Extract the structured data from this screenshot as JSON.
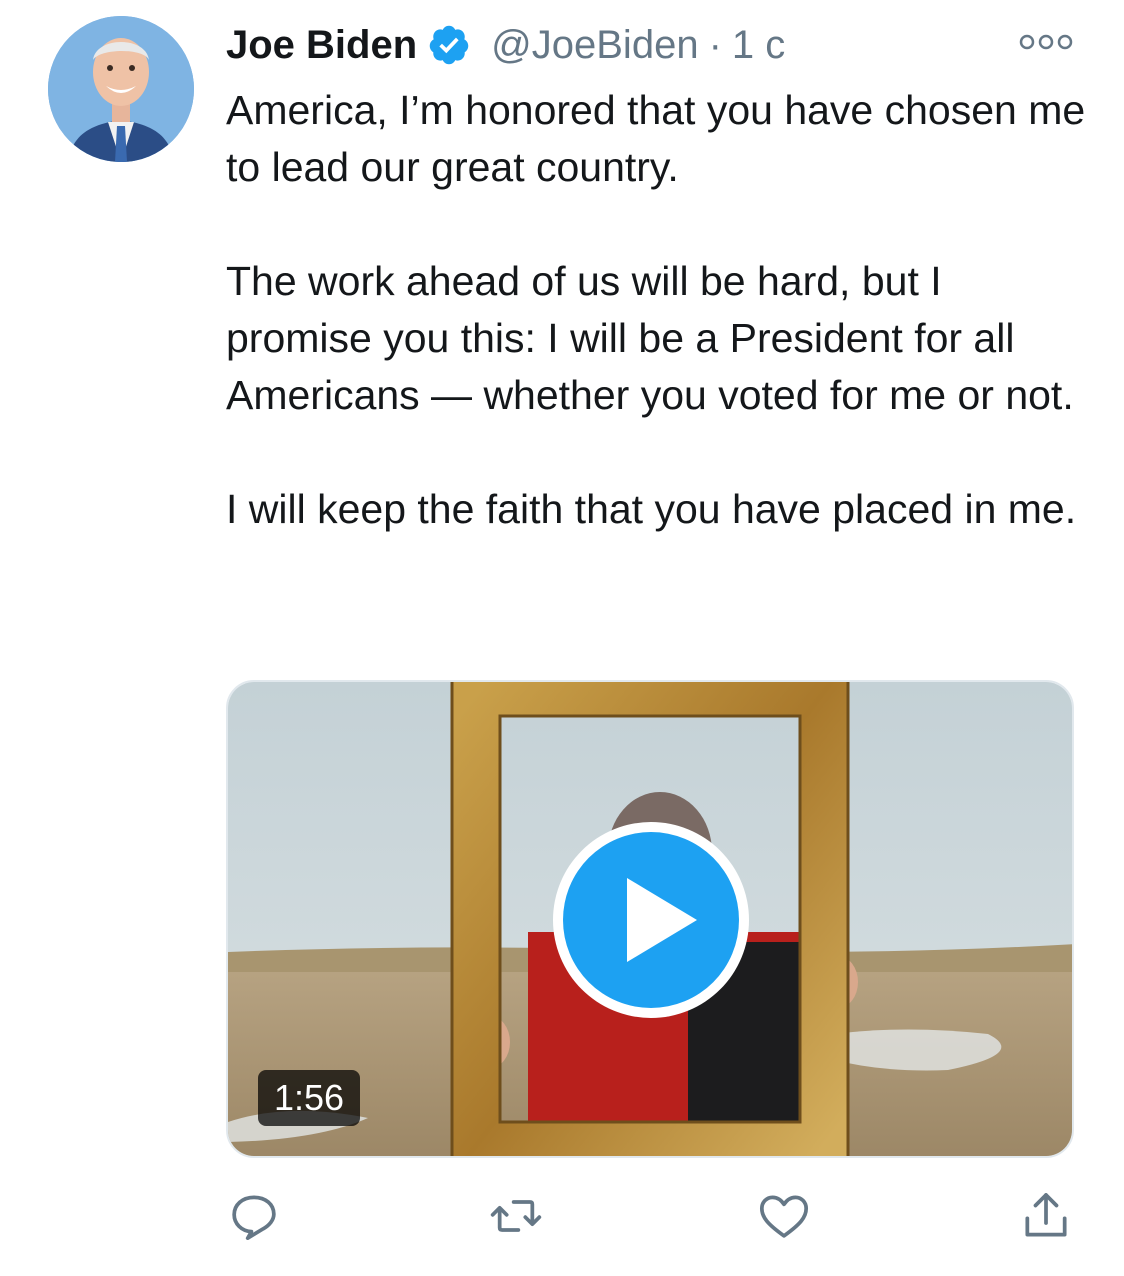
{
  "tweet": {
    "author_name": "Joe Biden",
    "handle": "@JoeBiden",
    "separator": "·",
    "time": "1 c",
    "paragraphs": [
      "America, I’m honored that you have chosen me to lead our great country.",
      "The work ahead of us will be hard, but I promise you this: I will be a President for all Americans — whether you voted for me or not.",
      "I will keep the faith that you have placed in me."
    ],
    "media": {
      "type": "video",
      "duration": "1:56"
    }
  },
  "icons": {
    "verified": "verified-badge-icon",
    "more": "more-options-icon",
    "play": "play-icon",
    "reply": "reply-icon",
    "retweet": "retweet-icon",
    "like": "like-icon",
    "share": "share-icon"
  },
  "colors": {
    "accent": "#1da1f2",
    "secondary_text": "#657786",
    "primary_text": "#14171a",
    "icon_gray": "#657786"
  }
}
